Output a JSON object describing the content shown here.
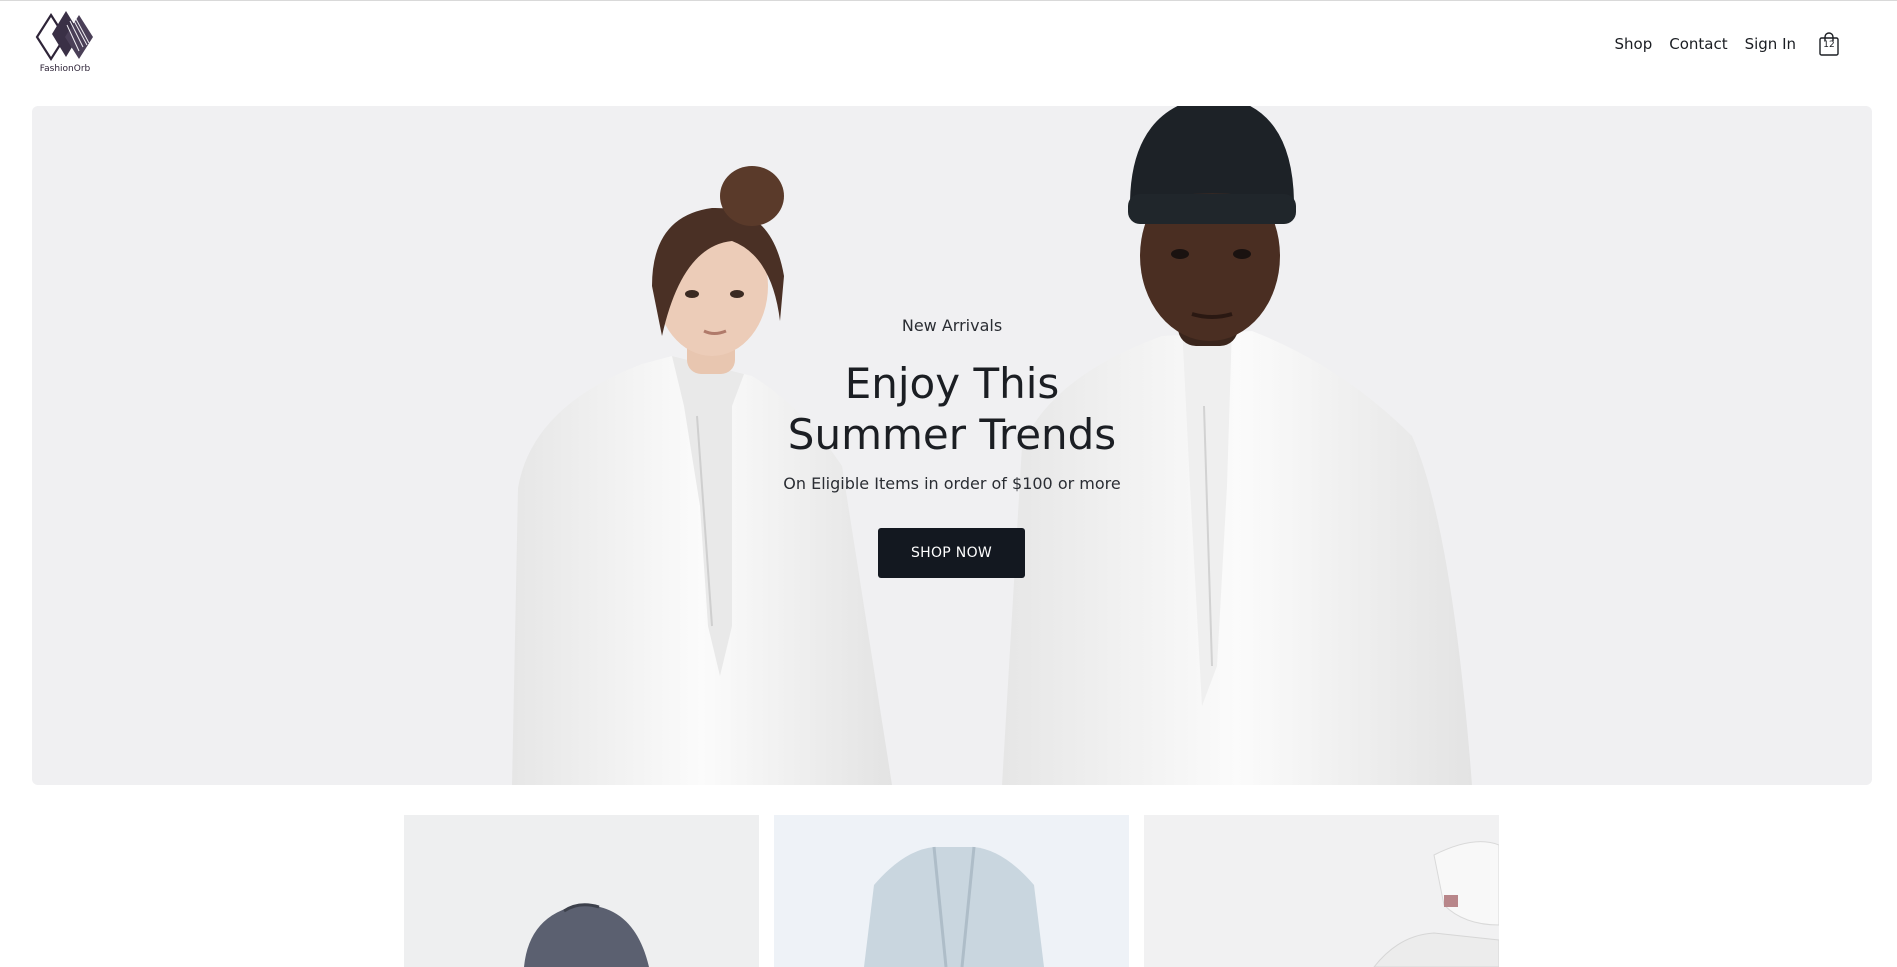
{
  "brand": {
    "name": "FashionOrb",
    "logo_icon": "diamond-logo-icon"
  },
  "nav": {
    "links": [
      {
        "label": "Shop"
      },
      {
        "label": "Contact"
      },
      {
        "label": "Sign In"
      }
    ],
    "cart": {
      "icon": "shopping-bag-icon",
      "count": "12"
    }
  },
  "hero": {
    "eyebrow": "New Arrivals",
    "headline_line1": "Enjoy This",
    "headline_line2": "Summer Trends",
    "subtitle": "On Eligible Items in order of $100 or more",
    "cta_label": "SHOP NOW",
    "background_color": "#f0f0f2",
    "button_color": "#131820"
  },
  "products": [
    {
      "image": "cap-product-image"
    },
    {
      "image": "cardigan-product-image"
    },
    {
      "image": "sneakers-product-image"
    }
  ]
}
